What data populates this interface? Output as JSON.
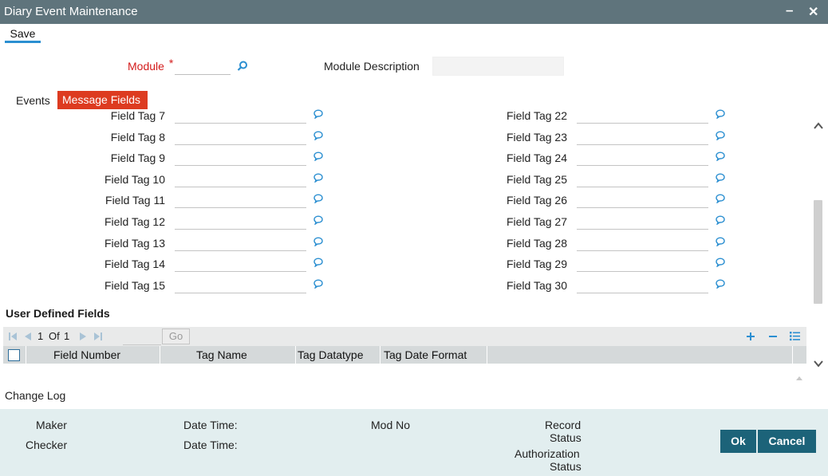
{
  "window": {
    "title": "Diary Event Maintenance",
    "minimize_glyph": "–",
    "close_glyph": "✕"
  },
  "toolbar": {
    "save_label": "Save"
  },
  "header": {
    "module_label": "Module",
    "required_mark": "*",
    "module_value": "",
    "module_description_label": "Module Description",
    "module_description_value": ""
  },
  "tabs": [
    {
      "label": "Events",
      "active": false
    },
    {
      "label": "Message Fields",
      "active": true
    }
  ],
  "field_tags_left": [
    {
      "label": "Field Tag 7",
      "value": ""
    },
    {
      "label": "Field Tag 8",
      "value": ""
    },
    {
      "label": "Field Tag 9",
      "value": ""
    },
    {
      "label": "Field Tag 10",
      "value": ""
    },
    {
      "label": "Field Tag 11",
      "value": ""
    },
    {
      "label": "Field Tag 12",
      "value": ""
    },
    {
      "label": "Field Tag 13",
      "value": ""
    },
    {
      "label": "Field Tag 14",
      "value": ""
    },
    {
      "label": "Field Tag 15",
      "value": ""
    }
  ],
  "field_tags_right": [
    {
      "label": "Field Tag 22",
      "value": ""
    },
    {
      "label": "Field Tag 23",
      "value": ""
    },
    {
      "label": "Field Tag 24",
      "value": ""
    },
    {
      "label": "Field Tag 25",
      "value": ""
    },
    {
      "label": "Field Tag 26",
      "value": ""
    },
    {
      "label": "Field Tag 27",
      "value": ""
    },
    {
      "label": "Field Tag 28",
      "value": ""
    },
    {
      "label": "Field Tag 29",
      "value": ""
    },
    {
      "label": "Field Tag 30",
      "value": ""
    }
  ],
  "udf": {
    "title": "User Defined Fields",
    "pager": {
      "current": "1",
      "of_label": "Of",
      "total": "1",
      "go_label": "Go"
    },
    "columns": [
      "Field Number",
      "Tag Name",
      "Tag Datatype",
      "Tag Date Format"
    ]
  },
  "change_log_label": "Change Log",
  "footer": {
    "maker_label": "Maker",
    "checker_label": "Checker",
    "date_time_label_1": "Date Time:",
    "date_time_label_2": "Date Time:",
    "mod_no_label": "Mod No",
    "record_status_line1": "Record",
    "record_status_line2": "Status",
    "auth_status_line1": "Authorization",
    "auth_status_line2": "Status",
    "ok_label": "Ok",
    "cancel_label": "Cancel"
  },
  "colors": {
    "titlebar": "#5f747c",
    "active_tab": "#dd3b20",
    "required": "#d31b1b",
    "icon_blue": "#2b8fd1",
    "button": "#1c6379",
    "footer_bg": "#e2eeef"
  }
}
